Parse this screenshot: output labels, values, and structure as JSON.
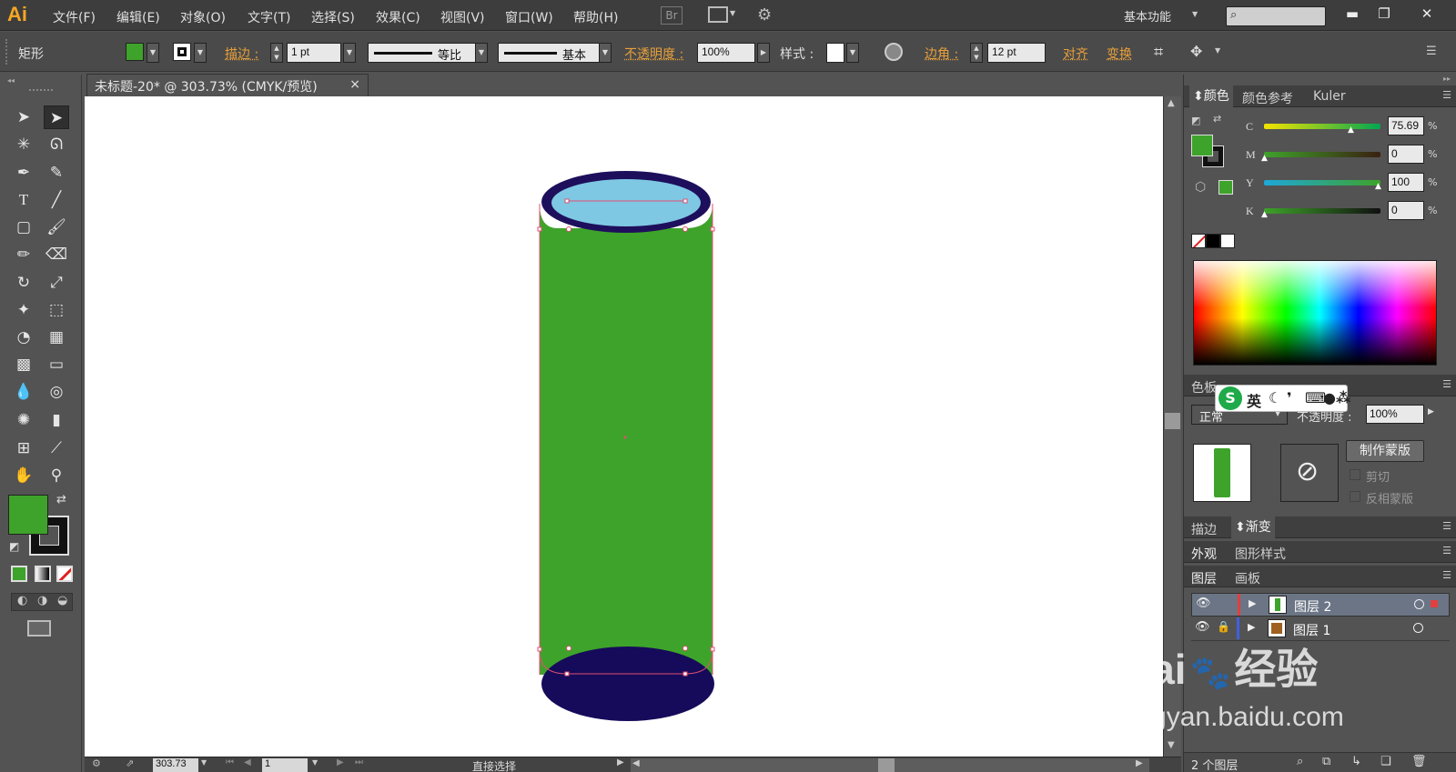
{
  "app": {
    "logo": "Ai",
    "workspace": "基本功能"
  },
  "menu": [
    "文件(F)",
    "编辑(E)",
    "对象(O)",
    "文字(T)",
    "选择(S)",
    "效果(C)",
    "视图(V)",
    "窗口(W)",
    "帮助(H)"
  ],
  "menu_extra": {
    "br": "Br"
  },
  "window_controls": {
    "minimize": "▬",
    "restore": "❐",
    "close": "✕"
  },
  "control": {
    "object_type": "矩形",
    "stroke_label": "描边 :",
    "stroke_value": "1 pt",
    "profile_label": "等比",
    "brush_label": "基本",
    "opacity_label": "不透明度 :",
    "opacity_value": "100%",
    "style_label": "样式 :",
    "corner_label": "边角 :",
    "corner_value": "12 pt",
    "align_label": "对齐",
    "transform_label": "变换",
    "fill_color": "#3ea32a"
  },
  "document": {
    "tab_title": "未标题-20* @ 303.73% (CMYK/预览)",
    "tab_close": "×"
  },
  "status": {
    "zoom": "303.73",
    "page": "1",
    "tool": "直接选择"
  },
  "color_panel": {
    "tabs": [
      "颜色",
      "颜色参考",
      "Kuler"
    ],
    "channels": [
      {
        "label": "C",
        "value": "75.69",
        "unit": "%"
      },
      {
        "label": "M",
        "value": "0",
        "unit": "%"
      },
      {
        "label": "Y",
        "value": "100",
        "unit": "%"
      },
      {
        "label": "K",
        "value": "0",
        "unit": "%"
      }
    ]
  },
  "transparency_panel": {
    "partial_tab": "色板",
    "mode": "正常",
    "opacity_label": "不透明度 :",
    "opacity_value": "100%",
    "make_mask": "制作蒙版",
    "clip": "剪切",
    "invert_mask": "反相蒙版"
  },
  "stroke_gradient_tabs": [
    "描边",
    "渐变"
  ],
  "appearance_tabs": [
    "外观",
    "图形样式"
  ],
  "layers_tabs": [
    "图层",
    "画板"
  ],
  "layers": [
    {
      "name": "图层 2",
      "color": "#e04040"
    },
    {
      "name": "图层 1",
      "color": "#4060e0"
    }
  ],
  "layers_footer": "2 个图层",
  "ime": {
    "lang": "英"
  },
  "watermark": {
    "brand": "Bai",
    "brand2": "经验",
    "url": "jingyan.baidu.com"
  },
  "shape_colors": {
    "body": "#3ea32a",
    "top_fill": "#7ec8e3",
    "rim": "#1e0f5c",
    "bottom": "#160a5a",
    "anchor": "#e05070"
  }
}
